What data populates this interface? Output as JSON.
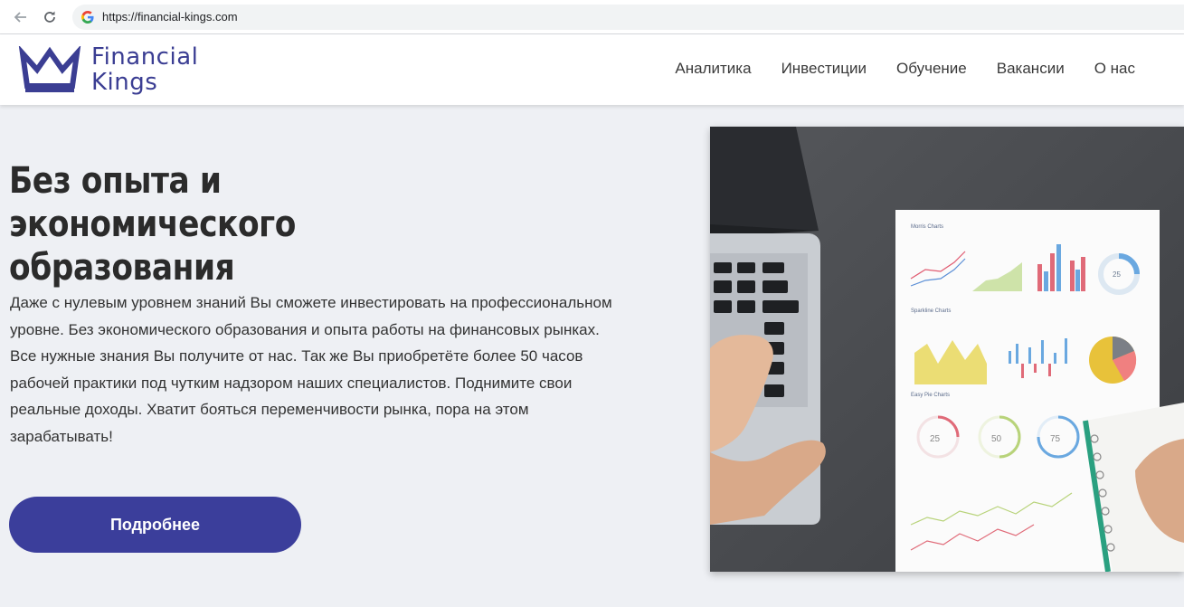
{
  "browser": {
    "url": "https://financial-kings.com"
  },
  "logo": {
    "line1": "Financial",
    "line2": "Kings",
    "color": "#3b3e93"
  },
  "nav": {
    "items": [
      {
        "label": "Аналитика"
      },
      {
        "label": "Инвестиции"
      },
      {
        "label": "Обучение"
      },
      {
        "label": "Вакансии"
      },
      {
        "label": "О нас"
      }
    ]
  },
  "hero": {
    "title_line1": "Без опыта и экономического",
    "title_line2": "образования",
    "text_lines": [
      "Даже с нулевым уровнем знаний Вы сможете инвестировать на профессиональном",
      "уровне. Без экономического образования и опыта работы на финансовых рынках.",
      "Все нужные знания Вы получите от нас. Так же Вы приобретёте более 50 часов",
      "рабочей практики под чутким надзором наших специалистов. Поднимите свои",
      "реальные доходы. Хватит бояться переменчивости рынка, пора на этом",
      "зарабатывать!"
    ],
    "button_label": "Подробнее",
    "accent_color": "#3b3e9b"
  },
  "image": {
    "chart_titles": {
      "morris": "Morris Charts",
      "sparkline": "Sparkline Charts",
      "pie": "Easy Pie Charts"
    },
    "donut_labels": [
      "25",
      "25",
      "50",
      "75"
    ]
  }
}
